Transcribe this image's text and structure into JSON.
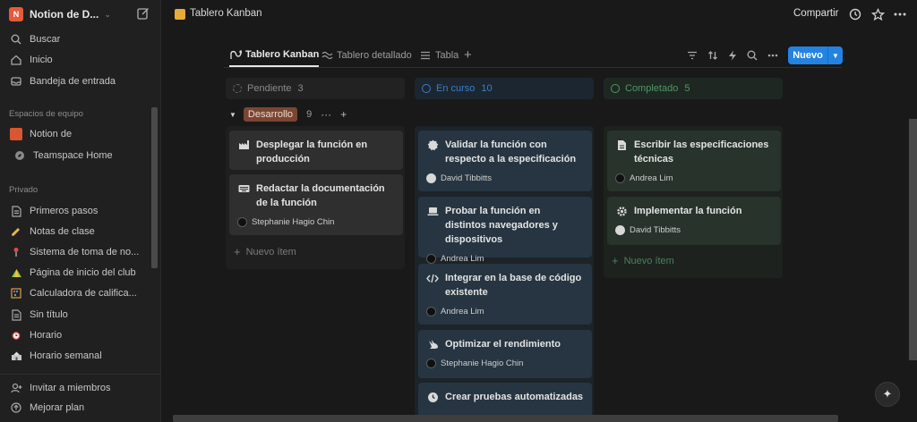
{
  "workspace": {
    "name": "Notion de D...",
    "logo_letter": "N"
  },
  "sidebar": {
    "nav": [
      {
        "label": "Buscar",
        "icon": "search-icon"
      },
      {
        "label": "Inicio",
        "icon": "home-icon"
      },
      {
        "label": "Bandeja de entrada",
        "icon": "inbox-icon"
      }
    ],
    "team_section": "Espacios de equipo",
    "team": [
      {
        "label": "Notion de",
        "icon": "house-emoji-icon"
      },
      {
        "label": "Teamspace Home",
        "icon": "compass-icon"
      }
    ],
    "private_section": "Privado",
    "private": [
      {
        "label": "Primeros pasos",
        "icon": "page-icon"
      },
      {
        "label": "Notas de clase",
        "icon": "pencil-icon"
      },
      {
        "label": "Sistema de toma de no...",
        "icon": "pin-icon"
      },
      {
        "label": "Página de inicio del club",
        "icon": "tent-icon"
      },
      {
        "label": "Calculadora de califica...",
        "icon": "abacus-icon"
      },
      {
        "label": "Sin título",
        "icon": "page-icon"
      },
      {
        "label": "Horario",
        "icon": "alarm-clock-icon"
      },
      {
        "label": "Horario semanal",
        "icon": "school-icon"
      }
    ],
    "footer": [
      {
        "label": "Invitar a miembros",
        "icon": "invite-members-icon"
      },
      {
        "label": "Mejorar plan",
        "icon": "upgrade-icon"
      }
    ]
  },
  "topbar": {
    "page_title": "Tablero Kanban",
    "share_label": "Compartir"
  },
  "views": {
    "tabs": [
      {
        "label": "Tablero Kanban",
        "icon": "board-icon",
        "active": true
      },
      {
        "label": "Tablero detallado",
        "icon": "wave-icon",
        "active": false
      },
      {
        "label": "Tabla",
        "icon": "table-icon",
        "active": false
      }
    ],
    "new_button": "Nuevo"
  },
  "colors": {
    "pending": "#8a8a8a",
    "in_progress": "#3b7ec7",
    "done": "#4f9768",
    "pending_bg": "#252525",
    "in_progress_bg": "#1e2a33",
    "done_bg": "#212a24",
    "accent": "#2383e2",
    "group_tag": "#7a4634"
  },
  "board": {
    "group": {
      "label": "Desarrollo",
      "count": "9"
    },
    "columns": [
      {
        "name": "Pendiente",
        "count": "3",
        "status": "pending",
        "cards": [
          {
            "title": "Desplegar la función en producción",
            "icon": "factory-icon",
            "assignee": ""
          },
          {
            "title": "Redactar la documentación de la función",
            "icon": "keyboard-icon",
            "assignee": "Stephanie Hagio Chin"
          }
        ],
        "add_label": "Nuevo ítem"
      },
      {
        "name": "En curso",
        "count": "10",
        "status": "in_progress",
        "cards": [
          {
            "title": "Validar la función con respecto a la especificación",
            "icon": "badge-check-icon",
            "assignee": "David Tibbitts"
          },
          {
            "title": "Probar la función en distintos navegadores y dispositivos",
            "icon": "laptop-icon",
            "assignee": "Andrea Lim"
          },
          {
            "title": "Integrar en la base de código existente",
            "icon": "code-icon",
            "assignee": "Andrea Lim"
          },
          {
            "title": "Optimizar el rendimiento",
            "icon": "rabbit-icon",
            "assignee": "Stephanie Hagio Chin"
          },
          {
            "title": "Crear pruebas automatizadas",
            "icon": "clock-icon",
            "assignee": ""
          }
        ]
      },
      {
        "name": "Completado",
        "count": "5",
        "status": "done",
        "cards": [
          {
            "title": "Escribir las especificaciones técnicas",
            "icon": "document-icon",
            "assignee": "Andrea Lim"
          },
          {
            "title": "Implementar la función",
            "icon": "gear-icon",
            "assignee": "David Tibbitts"
          }
        ],
        "add_label": "Nuevo ítem"
      }
    ]
  }
}
